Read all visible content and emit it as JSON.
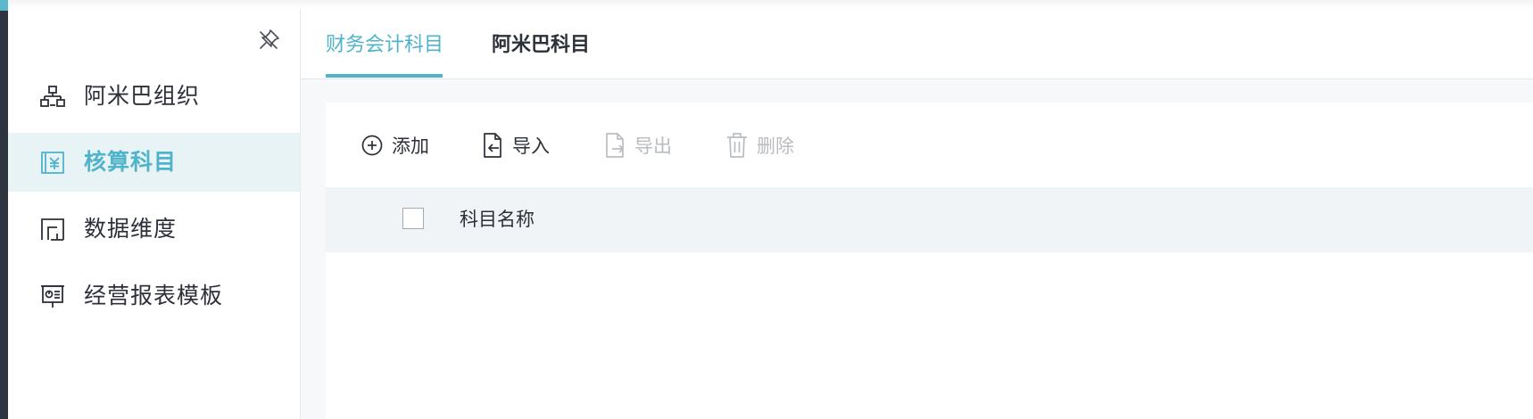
{
  "sidebar": {
    "pin_icon": "unpin-icon",
    "items": [
      {
        "label": "阿米巴组织",
        "icon": "org-chart-icon",
        "active": false
      },
      {
        "label": "核算科目",
        "icon": "yuan-ledger-icon",
        "active": true
      },
      {
        "label": "数据维度",
        "icon": "dimension-icon",
        "active": false
      },
      {
        "label": "经营报表模板",
        "icon": "report-board-icon",
        "active": false
      }
    ]
  },
  "tabs": [
    {
      "label": "财务会计科目",
      "active": true
    },
    {
      "label": "阿米巴科目",
      "active": false
    }
  ],
  "toolbar": {
    "add_label": "添加",
    "import_label": "导入",
    "export_label": "导出",
    "delete_label": "删除"
  },
  "table": {
    "columns": [
      "科目名称"
    ]
  },
  "colors": {
    "accent": "#4fb3c9",
    "active_bg": "#e8f3f6",
    "text": "#2c3038",
    "disabled_text": "#b9bdc2"
  }
}
